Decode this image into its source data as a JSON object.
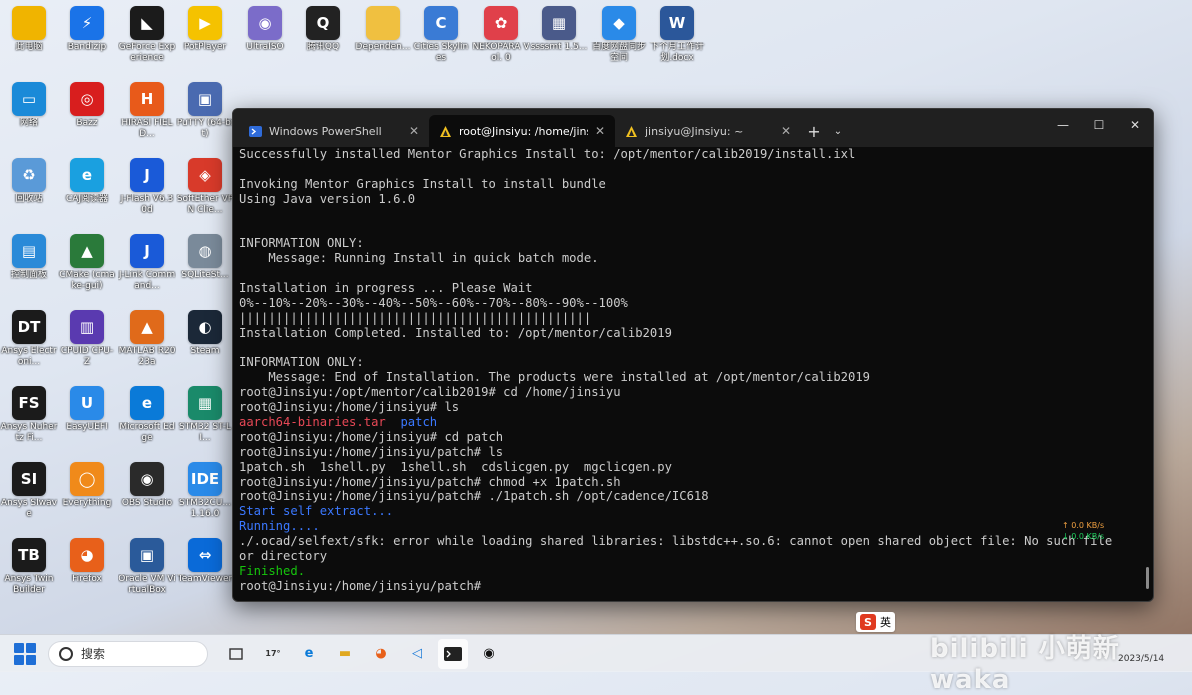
{
  "desktop": {
    "icons": [
      {
        "label": "此电脑",
        "glyph": "",
        "color": "#f0b400"
      },
      {
        "label": "Bandizip",
        "glyph": "⚡",
        "color": "#1a73e8"
      },
      {
        "label": "GeForce Experience",
        "glyph": "◣",
        "color": "#1b1b1b"
      },
      {
        "label": "PotPlayer",
        "glyph": "▶",
        "color": "#f5c200"
      },
      {
        "label": "UltraISO",
        "glyph": "◉",
        "color": "#7b6cc9"
      },
      {
        "label": "腾讯QQ",
        "glyph": "Q",
        "color": "#222222"
      },
      {
        "label": "Dependen...",
        "glyph": "",
        "color": "#f0c040"
      },
      {
        "label": "Cities Skylines",
        "glyph": "C",
        "color": "#3a7bd5"
      },
      {
        "label": "NEKOPARA Vol. 0",
        "glyph": "✿",
        "color": "#e0404a"
      },
      {
        "label": "ssssmt 1.5...",
        "glyph": "▦",
        "color": "#4a5a8a"
      },
      {
        "label": "百度网盘同步空间",
        "glyph": "◆",
        "color": "#2a8ae8"
      },
      {
        "label": "下个月工作计划.docx",
        "glyph": "W",
        "color": "#2b579a"
      },
      {
        "label": "网络",
        "glyph": "▭",
        "color": "#1a8ad8"
      },
      {
        "label": "Bazz",
        "glyph": "◎",
        "color": "#d81e1e"
      },
      {
        "label": "HIRASI FIELD...",
        "glyph": "H",
        "color": "#e85a1a"
      },
      {
        "label": "PuTTY (64-bit)",
        "glyph": "▣",
        "color": "#4a6ab0"
      },
      {
        "label": "回收站",
        "glyph": "♻",
        "color": "#5a9ad8"
      },
      {
        "label": "CAJ阅读器",
        "glyph": "e",
        "color": "#1aa0e0"
      },
      {
        "label": "J-Flash V6.30d",
        "glyph": "J",
        "color": "#1a5ad8"
      },
      {
        "label": "SoftEther VPN Clie...",
        "glyph": "◈",
        "color": "#d83a2a"
      },
      {
        "label": "控制面板",
        "glyph": "▤",
        "color": "#2a8ad8"
      },
      {
        "label": "CMake (cmake-gui)",
        "glyph": "▲",
        "color": "#2a7a3a"
      },
      {
        "label": "J-Link Command...",
        "glyph": "J",
        "color": "#1a5ad8"
      },
      {
        "label": "SQLiteSt...",
        "glyph": "◍",
        "color": "#7a8a9a"
      },
      {
        "label": "Ansys Electroni...",
        "glyph": "DT",
        "color": "#1b1b1b"
      },
      {
        "label": "CPUID CPU-Z",
        "glyph": "▥",
        "color": "#5a3ab0"
      },
      {
        "label": "MATLAB R2023a",
        "glyph": "▲",
        "color": "#e06a1a"
      },
      {
        "label": "Steam",
        "glyph": "◐",
        "color": "#1b2838"
      },
      {
        "label": "Ansys Nuhertz Fi...",
        "glyph": "FS",
        "color": "#1b1b1b"
      },
      {
        "label": "EasyUEFI",
        "glyph": "U",
        "color": "#2a8ae8"
      },
      {
        "label": "Microsoft Edge",
        "glyph": "e",
        "color": "#0a7ad8"
      },
      {
        "label": "STM32 ST-LI...",
        "glyph": "▦",
        "color": "#1a8a6a"
      },
      {
        "label": "Ansys SIwave",
        "glyph": "SI",
        "color": "#1b1b1b"
      },
      {
        "label": "Everything",
        "glyph": "◯",
        "color": "#f08a1a"
      },
      {
        "label": "OBS Studio",
        "glyph": "◉",
        "color": "#2a2a2a"
      },
      {
        "label": "STM32CU... 1.16.0",
        "glyph": "IDE",
        "color": "#2a8ae8"
      },
      {
        "label": "Ansys Twin Builder",
        "glyph": "TB",
        "color": "#1b1b1b"
      },
      {
        "label": "Firefox",
        "glyph": "◕",
        "color": "#e8601a"
      },
      {
        "label": "Oracle VM VirtualBox",
        "glyph": "▣",
        "color": "#2a5a9a"
      },
      {
        "label": "TeamViewer",
        "glyph": "⇔",
        "color": "#0a6ad8"
      }
    ]
  },
  "terminal": {
    "tabs": [
      {
        "label": "Windows PowerShell",
        "icon": "powershell-icon",
        "active": false
      },
      {
        "label": "root@Jinsiyu: /home/jinsiyu/p",
        "icon": "linux-icon",
        "active": true
      },
      {
        "label": "jinsiyu@Jinsiyu: ~",
        "icon": "linux-icon",
        "active": false
      }
    ],
    "new_tab_label": "+",
    "dropdown_label": "⌄",
    "controls": {
      "minimize": "—",
      "maximize": "☐",
      "close": "✕"
    },
    "lines": [
      {
        "text": "Successfully installed Mentor Graphics Install to: /opt/mentor/calib2019/install.ixl",
        "color": ""
      },
      {
        "text": "",
        "color": ""
      },
      {
        "text": "Invoking Mentor Graphics Install to install bundle",
        "color": ""
      },
      {
        "text": "Using Java version 1.6.0",
        "color": ""
      },
      {
        "text": "",
        "color": ""
      },
      {
        "text": "",
        "color": ""
      },
      {
        "text": "INFORMATION ONLY:",
        "color": ""
      },
      {
        "text": "    Message: Running Install in quick batch mode.",
        "color": ""
      },
      {
        "text": "",
        "color": ""
      },
      {
        "text": "Installation in progress ... Please Wait",
        "color": ""
      },
      {
        "text": "0%--10%--20%--30%--40%--50%--60%--70%--80%--90%--100%",
        "color": ""
      },
      {
        "text": "||||||||||||||||||||||||||||||||||||||||||||||||",
        "color": ""
      },
      {
        "text": "Installation Completed. Installed to: /opt/mentor/calib2019",
        "color": ""
      },
      {
        "text": "",
        "color": ""
      },
      {
        "text": "INFORMATION ONLY:",
        "color": ""
      },
      {
        "text": "    Message: End of Installation. The products were installed at /opt/mentor/calib2019",
        "color": ""
      },
      {
        "text": "root@Jinsiyu:/opt/mentor/calib2019# cd /home/jinsiyu",
        "color": ""
      },
      {
        "text": "root@Jinsiyu:/home/jinsiyu# ls",
        "color": ""
      },
      {
        "text": "",
        "color": "",
        "parts": [
          {
            "text": "aarch64-binaries.tar",
            "color": "red"
          },
          {
            "text": "  ",
            "color": ""
          },
          {
            "text": "patch",
            "color": "blue"
          }
        ]
      },
      {
        "text": "root@Jinsiyu:/home/jinsiyu# cd patch",
        "color": ""
      },
      {
        "text": "root@Jinsiyu:/home/jinsiyu/patch# ls",
        "color": ""
      },
      {
        "text": "1patch.sh  1shell.py  1shell.sh  cdslicgen.py  mgclicgen.py",
        "color": ""
      },
      {
        "text": "root@Jinsiyu:/home/jinsiyu/patch# chmod +x 1patch.sh",
        "color": ""
      },
      {
        "text": "root@Jinsiyu:/home/jinsiyu/patch# ./1patch.sh /opt/cadence/IC618",
        "color": ""
      },
      {
        "text": "Start self extract...",
        "color": "blue"
      },
      {
        "text": "Running....",
        "color": "blue"
      },
      {
        "text": "./.ocad/selfext/sfk: error while loading shared libraries: libstdc++.so.6: cannot open shared object file: No such file",
        "color": ""
      },
      {
        "text": "or directory",
        "color": ""
      },
      {
        "text": "Finished.",
        "color": "green"
      },
      {
        "text": "root@Jinsiyu:/home/jinsiyu/patch#",
        "color": ""
      }
    ]
  },
  "netspeed": {
    "up": "↑ 0.0 KB/s",
    "down": "↓ 0.0 KB/s"
  },
  "taskbar": {
    "search_placeholder": "搜索",
    "weather": "17°"
  },
  "ime": {
    "label": "英"
  },
  "watermark": "bilibili 小萌新waka",
  "clock": "2023/5/14"
}
